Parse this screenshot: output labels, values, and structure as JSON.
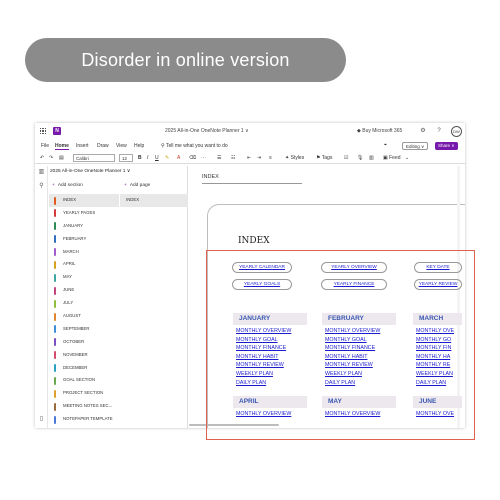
{
  "banner": {
    "text": "Disorder in online version"
  },
  "titlebar": {
    "document_title": "2025 All-in-One OneNote Planner 1 ∨",
    "buy_label": "Buy Microsoft 365",
    "avatar_initials": "DW",
    "app_icon_letter": "N"
  },
  "menubar": {
    "items": [
      "File",
      "Home",
      "Insert",
      "Draw",
      "View",
      "Help"
    ],
    "search_placeholder": "Tell me what you want to do",
    "editing_label": "Editing ∨",
    "share_label": "Share ∨"
  },
  "toolbar": {
    "font": "Calibri",
    "size": "12",
    "styles_label": "Styles",
    "tags_label": "Tags",
    "feed_label": "Feed"
  },
  "navigation": {
    "notebook_name": "2025 All-in-One OneNote Planner 1 ∨",
    "add_section": "Add section",
    "add_page": "Add page",
    "sections": [
      {
        "label": "INDEX",
        "color": "#e05a1e"
      },
      {
        "label": "YEARLY PAGES",
        "color": "#d63b3b"
      },
      {
        "label": "JANUARY",
        "color": "#2e8b57"
      },
      {
        "label": "FEBRUARY",
        "color": "#2f6fbf"
      },
      {
        "label": "MARCH",
        "color": "#a35cc9"
      },
      {
        "label": "APRIL",
        "color": "#d6a21e"
      },
      {
        "label": "MAY",
        "color": "#3aa8a0"
      },
      {
        "label": "JUNE",
        "color": "#c0457f"
      },
      {
        "label": "JULY",
        "color": "#8fbf3a"
      },
      {
        "label": "AUGUST",
        "color": "#e0862e"
      },
      {
        "label": "SEPTEMBER",
        "color": "#3a8fd6"
      },
      {
        "label": "OCTOBER",
        "color": "#7a4fc0"
      },
      {
        "label": "NOVEMBER",
        "color": "#d64b6b"
      },
      {
        "label": "DECEMBER",
        "color": "#2aa0c0"
      },
      {
        "label": "GOAL SECTION",
        "color": "#6aa84f"
      },
      {
        "label": "PROJECT SECTION",
        "color": "#e0a030"
      },
      {
        "label": "MEETING NOTES SEC...",
        "color": "#9a6a3a"
      },
      {
        "label": "NOTEPAPER TEMPLATE",
        "color": "#4a7ad6"
      }
    ],
    "pages": [
      "INDEX"
    ]
  },
  "page": {
    "title": "INDEX",
    "heading": "INDEX",
    "top_links": [
      "YEARLY CALENDAR",
      "YEARLY OVERVIEW",
      "KEY DATE",
      "YEARLY GOALS",
      "YEARLY FINANCE",
      "YEARLY REVIEW"
    ],
    "months_row1": [
      {
        "name": "JANUARY",
        "links": [
          "MONTHLY OVERVIEW",
          "MONTHLY GOAL",
          "MONTHLY FINANCE",
          "MONTHLY HABIT",
          "MONTHLY REVIEW",
          "WEEKLY PLAN",
          "DAILY PLAN"
        ]
      },
      {
        "name": "FEBRUARY",
        "links": [
          "MONTHLY OVERVIEW",
          "MONTHLY GOAL",
          "MONTHLY FINANCE",
          "MONTHLY HABIT",
          "MONTHLY REVIEW",
          "WEEKLY PLAN",
          "DAILY PLAN"
        ]
      },
      {
        "name": "MARCH",
        "links": [
          "MONTHLY OVE",
          "MONTHLY GO",
          "MONTHLY FIN",
          "MONTHLY HA",
          "MONTHLY RE",
          "WEEKLY PLAN",
          "DAILY PLAN"
        ]
      }
    ],
    "months_row2": [
      {
        "name": "APRIL",
        "links": [
          "MONTHLY OVERVIEW"
        ]
      },
      {
        "name": "MAY",
        "links": [
          "MONTHLY OVERVIEW"
        ]
      },
      {
        "name": "JUNE",
        "links": [
          "MONTHLY OVE"
        ]
      }
    ]
  },
  "colors": {
    "accent": "#7719aa",
    "link": "#1a1acf",
    "month_header_text": "#3a56b0",
    "highlight_border": "#e0614f"
  }
}
